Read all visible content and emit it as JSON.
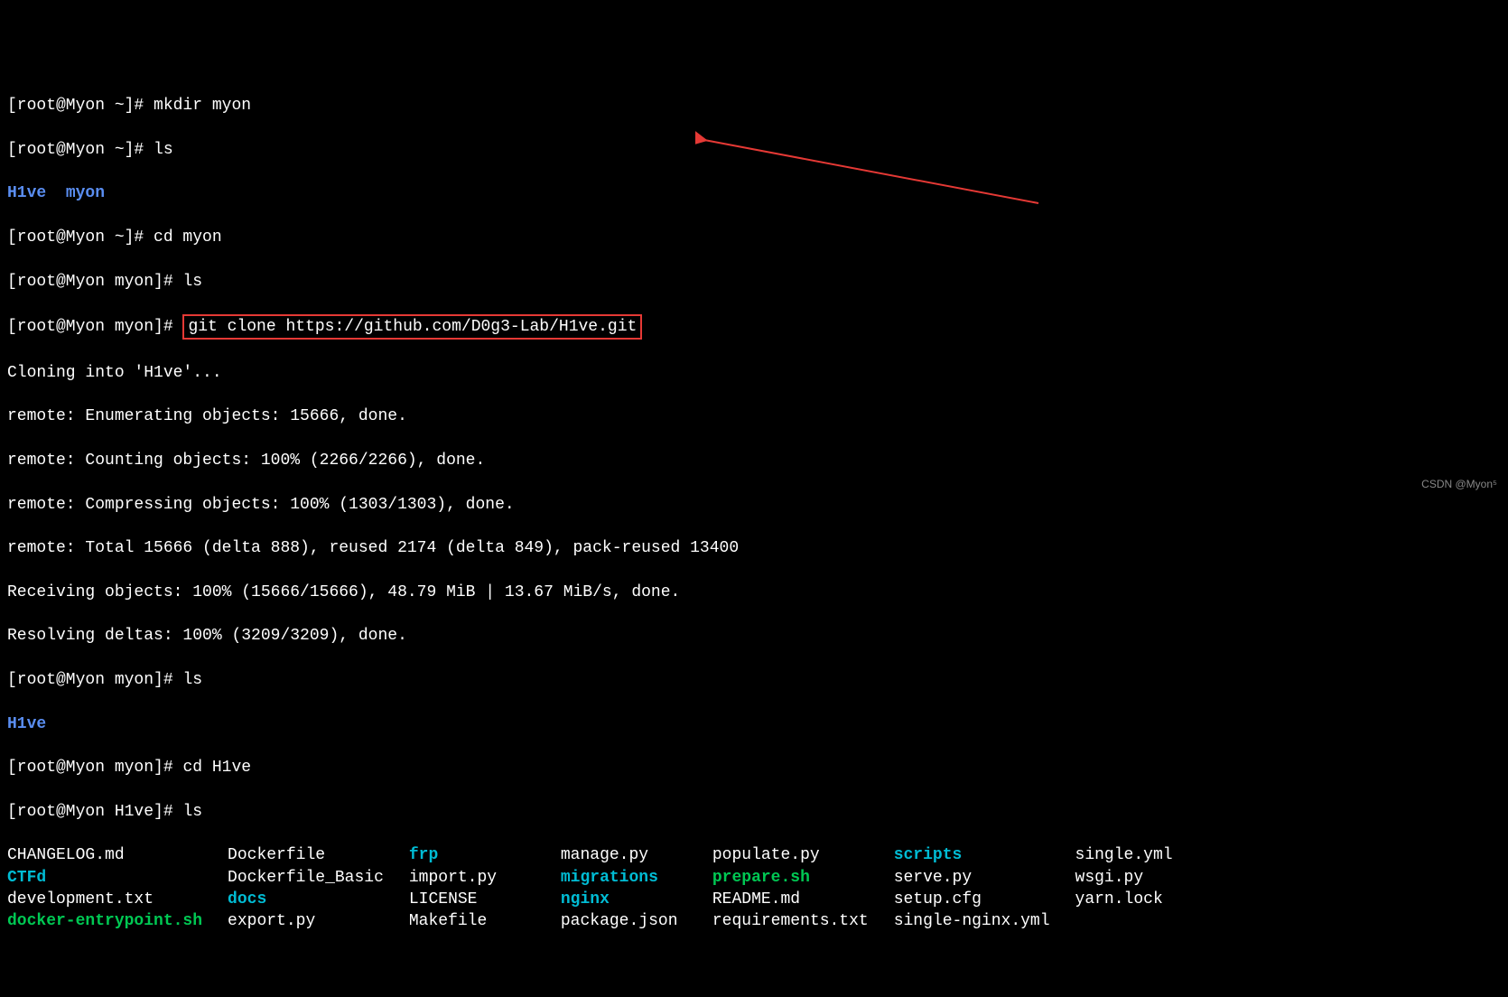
{
  "lines": {
    "l1_prompt": "[root@Myon ~]# ",
    "l1_cmd": "mkdir myon",
    "l2_prompt": "[root@Myon ~]# ",
    "l2_cmd": "ls",
    "l3_a": "H1ve",
    "l3_b": "myon",
    "l4_prompt": "[root@Myon ~]# ",
    "l4_cmd": "cd myon",
    "l5_prompt": "[root@Myon myon]# ",
    "l5_cmd": "ls",
    "l6_prompt": "[root@Myon myon]# ",
    "l6_cmd": "git clone https://github.com/D0g3-Lab/H1ve.git",
    "l7": "Cloning into 'H1ve'...",
    "l8": "remote: Enumerating objects: 15666, done.",
    "l9": "remote: Counting objects: 100% (2266/2266), done.",
    "l10": "remote: Compressing objects: 100% (1303/1303), done.",
    "l11": "remote: Total 15666 (delta 888), reused 2174 (delta 849), pack-reused 13400",
    "l12": "Receiving objects: 100% (15666/15666), 48.79 MiB | 13.67 MiB/s, done.",
    "l13": "Resolving deltas: 100% (3209/3209), done.",
    "l14_prompt": "[root@Myon myon]# ",
    "l14_cmd": "ls",
    "l15": "H1ve",
    "l16_prompt": "[root@Myon myon]# ",
    "l16_cmd": "cd H1ve",
    "l17_prompt": "[root@Myon H1ve]# ",
    "l17_cmd": "ls"
  },
  "ls_rows": [
    [
      {
        "text": "CHANGELOG.md",
        "cls": "white"
      },
      {
        "text": "Dockerfile",
        "cls": "white"
      },
      {
        "text": "frp",
        "cls": "cyan"
      },
      {
        "text": "manage.py",
        "cls": "white"
      },
      {
        "text": "populate.py",
        "cls": "white"
      },
      {
        "text": "scripts",
        "cls": "cyan"
      },
      {
        "text": "single.yml",
        "cls": "white"
      }
    ],
    [
      {
        "text": "CTFd",
        "cls": "cyan"
      },
      {
        "text": "Dockerfile_Basic",
        "cls": "white"
      },
      {
        "text": "import.py",
        "cls": "white"
      },
      {
        "text": "migrations",
        "cls": "cyan"
      },
      {
        "text": "prepare.sh",
        "cls": "green"
      },
      {
        "text": "serve.py",
        "cls": "white"
      },
      {
        "text": "wsgi.py",
        "cls": "white"
      }
    ],
    [
      {
        "text": "development.txt",
        "cls": "white"
      },
      {
        "text": "docs",
        "cls": "cyan"
      },
      {
        "text": "LICENSE",
        "cls": "white"
      },
      {
        "text": "nginx",
        "cls": "cyan"
      },
      {
        "text": "README.md",
        "cls": "white"
      },
      {
        "text": "setup.cfg",
        "cls": "white"
      },
      {
        "text": "yarn.lock",
        "cls": "white"
      }
    ],
    [
      {
        "text": "docker-entrypoint.sh",
        "cls": "green"
      },
      {
        "text": "export.py",
        "cls": "white"
      },
      {
        "text": "Makefile",
        "cls": "white"
      },
      {
        "text": "package.json",
        "cls": "white"
      },
      {
        "text": "requirements.txt",
        "cls": "white"
      },
      {
        "text": "single-nginx.yml",
        "cls": "white"
      },
      {
        "text": "",
        "cls": "white"
      }
    ]
  ],
  "watermark": "CSDN @Myon⁵"
}
